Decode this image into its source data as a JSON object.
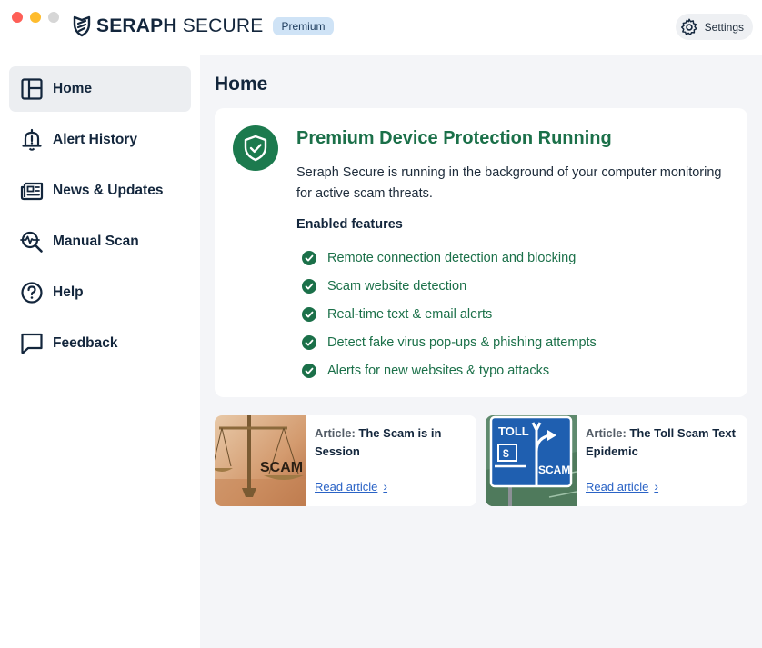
{
  "app": {
    "brand_bold": "SERAPH",
    "brand_light": " SECURE",
    "badge": "Premium",
    "settings_label": "Settings"
  },
  "sidebar": {
    "items": [
      {
        "label": "Home",
        "icon": "layout-icon",
        "active": true
      },
      {
        "label": "Alert History",
        "icon": "bell-icon"
      },
      {
        "label": "News & Updates",
        "icon": "newspaper-icon"
      },
      {
        "label": "Manual Scan",
        "icon": "scan-magnifier-icon"
      },
      {
        "label": "Help",
        "icon": "help-circle-icon"
      },
      {
        "label": "Feedback",
        "icon": "speech-bubble-icon"
      }
    ]
  },
  "main": {
    "title": "Home",
    "status": {
      "title": "Premium Device Protection Running",
      "description": "Seraph Secure is running in the background of your computer monitoring for active scam threats.",
      "features_heading": "Enabled features",
      "features": [
        "Remote connection detection and blocking",
        "Scam website detection",
        "Real-time text & email alerts",
        "Detect fake virus pop-ups & phishing attempts",
        "Alerts for new websites & typo attacks"
      ]
    },
    "articles": [
      {
        "prefix": "Article:",
        "title": "The Scam is in Session",
        "link": "Read article",
        "thumb_text": "SCAM"
      },
      {
        "prefix": "Article:",
        "title": "The Toll Scam Text Epidemic",
        "link": "Read article",
        "thumb_text_top": "TOLL",
        "thumb_text_bottom": "SCAM"
      }
    ]
  },
  "colors": {
    "accent_green": "#1b7049",
    "link_blue": "#2a63c6",
    "badge_bg": "#cfe3f6",
    "navy": "#13263c"
  }
}
